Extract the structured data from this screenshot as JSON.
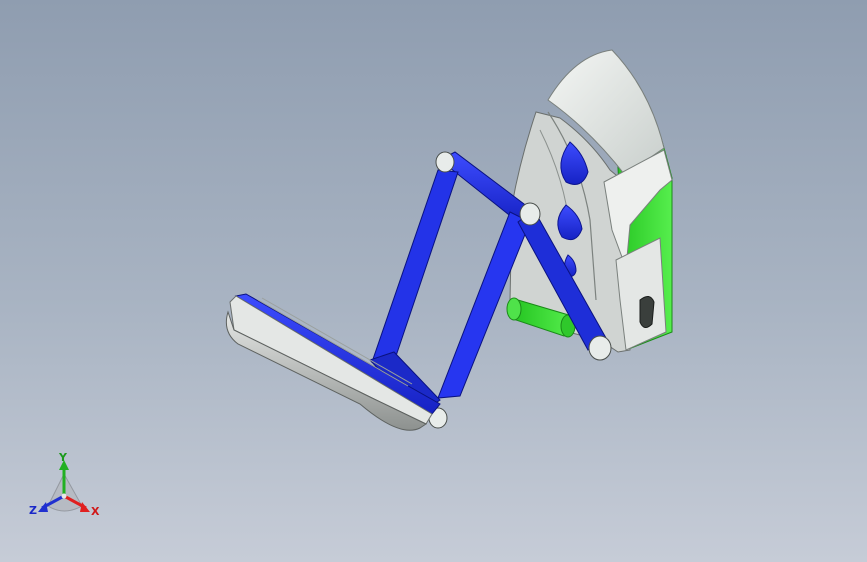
{
  "triad": {
    "y_label": "Y",
    "x_label": "X",
    "z_label": "Z"
  },
  "colors": {
    "background_top": "#8f9db0",
    "background_bottom": "#c6ccd7",
    "part_blue": "#1f2fe0",
    "part_green": "#2fd42a",
    "part_white": "#e8ecea",
    "axis_x": "#e02020",
    "axis_y": "#22b022",
    "axis_z": "#2030d0"
  }
}
